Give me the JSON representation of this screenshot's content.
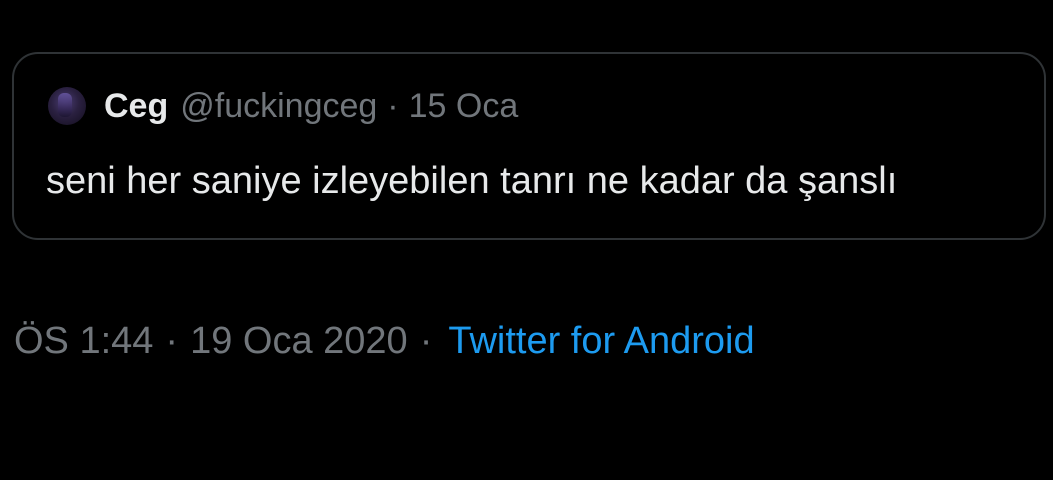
{
  "quoted_tweet": {
    "avatar_icon": "user-avatar",
    "display_name": "Ceg",
    "handle": "@fuckingceg",
    "separator": "·",
    "date": "15 Oca",
    "text": "seni her saniye izleyebilen tanrı ne kadar da şanslı"
  },
  "tweet_meta": {
    "time": "ÖS 1:44",
    "separator_1": "·",
    "date": "19 Oca 2020",
    "separator_2": "·",
    "source": "Twitter for Android"
  },
  "colors": {
    "background": "#000000",
    "text_primary": "#e7e9ea",
    "text_secondary": "#71767b",
    "border": "#2f3336",
    "link": "#1d9bf0"
  }
}
